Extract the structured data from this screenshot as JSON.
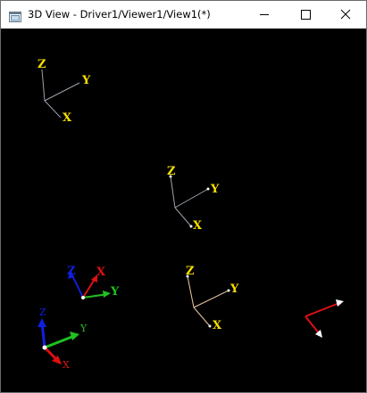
{
  "window": {
    "title": "3D View - Driver1/Viewer1/View1(*)",
    "buttons": {
      "minimize_icon": "minimize-icon",
      "maximize_icon": "maximize-icon",
      "close_icon": "close-icon"
    }
  },
  "viewport": {
    "background": "#000000",
    "triads": [
      {
        "labels": {
          "x": "X",
          "y": "Y",
          "z": "Z"
        },
        "label_color": "#f5e000",
        "line_color": "#9aa3ad"
      },
      {
        "labels": {
          "x": "X",
          "y": "Y",
          "z": "Z"
        },
        "label_color": "#f5e000",
        "line_color": "#9aa3ad"
      },
      {
        "labels": {
          "x": "X",
          "y": "Y",
          "z": "Z"
        },
        "label_color": "#f5e000",
        "line_color": "#f0c8a0"
      },
      {
        "labels": {
          "x": "X",
          "y": "Y",
          "z": "Z"
        },
        "x_color": "#e01010",
        "y_color": "#20c020",
        "z_color": "#1020e0"
      },
      {
        "labels": {
          "x": "X",
          "y": "Y",
          "z": "Z"
        },
        "x_color": "#e01010",
        "y_color": "#20c020",
        "z_color": "#1020e0"
      }
    ]
  }
}
